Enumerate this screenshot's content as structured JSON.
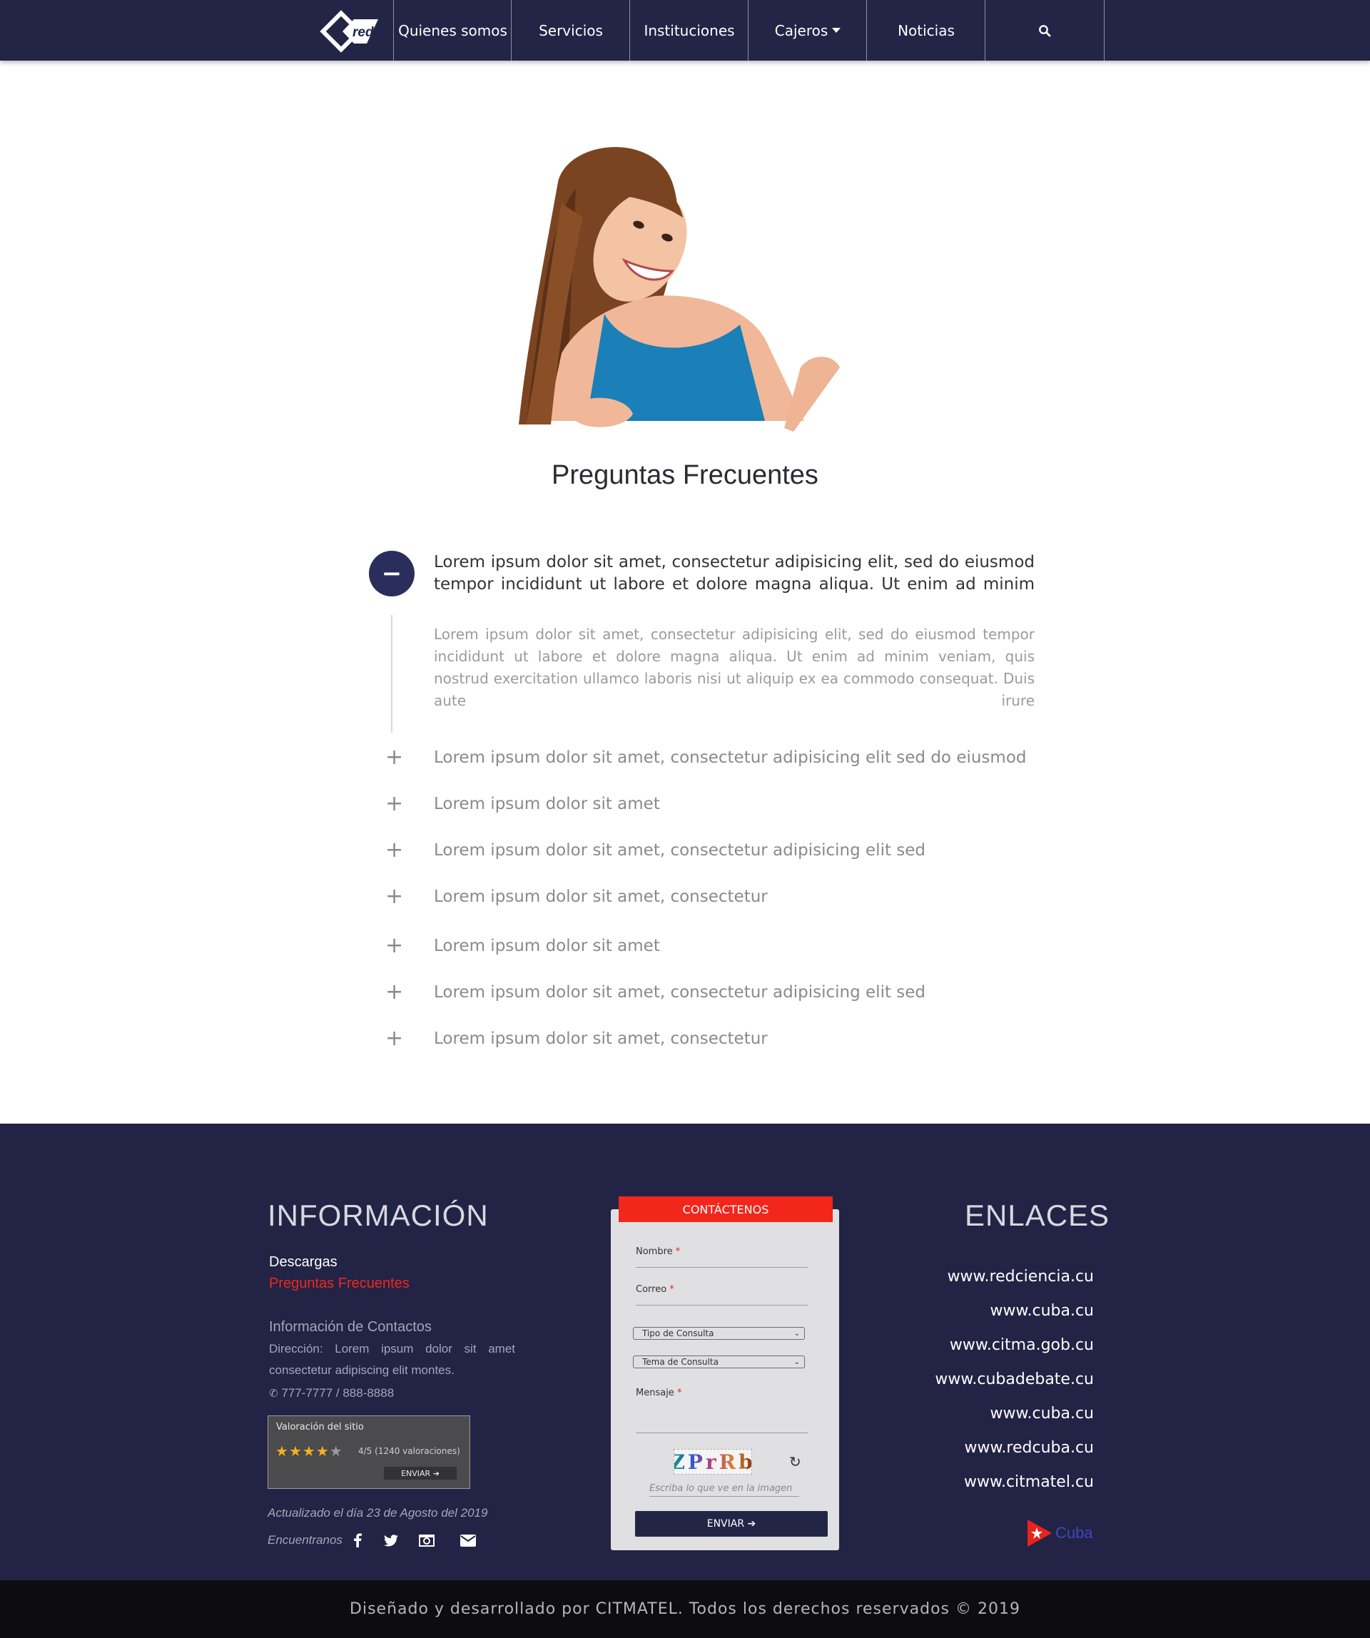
{
  "nav": {
    "logo_text": "red",
    "items": [
      {
        "label": "Quienes somos"
      },
      {
        "label": "Servicios"
      },
      {
        "label": "Instituciones"
      },
      {
        "label": "Cajeros"
      },
      {
        "label": "Noticias"
      }
    ],
    "search_icon": "search-icon"
  },
  "hero": {
    "image": "woman-pointing-down-photo"
  },
  "page_title": "Preguntas Frecuentes",
  "faq": {
    "open": {
      "toggle_symbol": "−",
      "question": "Lorem ipsum dolor sit amet, consectetur adipisicing elit, sed do eiusmod tempor incididunt ut labore et dolore magna aliqua. Ut enim ad minim",
      "answer": "Lorem ipsum dolor sit amet, consectetur adipisicing elit, sed do eiusmod tempor incididunt ut labore et dolore magna aliqua. Ut enim ad minim veniam, quis nostrud exercitation ullamco laboris nisi ut aliquip ex ea commodo consequat. Duis aute irure"
    },
    "toggle_symbol": "+",
    "items": [
      {
        "question": "Lorem ipsum dolor sit amet, consectetur adipisicing elit sed do eiusmod"
      },
      {
        "question": "Lorem ipsum dolor sit amet"
      },
      {
        "question": "Lorem ipsum dolor sit amet, consectetur adipisicing elit sed"
      },
      {
        "question": "Lorem ipsum dolor sit amet, consectetur"
      },
      {
        "question": "Lorem ipsum dolor sit amet"
      },
      {
        "question": "Lorem ipsum dolor sit amet, consectetur adipisicing elit sed"
      },
      {
        "question": "Lorem ipsum dolor sit amet, consectetur"
      }
    ]
  },
  "footer": {
    "info": {
      "title": "INFORMACIÓN",
      "downloads": "Descargas",
      "faq_link": "Preguntas Frecuentes",
      "contacts_title": "Información de Contactos",
      "address": "Dirección: Lorem ipsum dolor sit amet consectetur adipiscing elit montes.",
      "phone": "777-7777 / 888-8888",
      "rating": {
        "title": "Valoración del sitio",
        "stars_filled": 4,
        "stars_total": 5,
        "value": "4/5",
        "count": "(1240 valoraciones)",
        "submit": "ENVIAR"
      },
      "updated": "Actualizado el día 23 de Agosto del 2019",
      "find_us": "Encuentranos",
      "social": [
        "facebook-icon",
        "twitter-icon",
        "camera-icon",
        "envelope-icon"
      ]
    },
    "contact": {
      "header": "CONTÁCTENOS",
      "name_label": "Nombre",
      "email_label": "Correo",
      "required_mark": "*",
      "type_select": "Tipo de Consulta",
      "topic_select": "Tema de Consulta",
      "message_label": "Mensaje",
      "captcha_text": "ZPrRb",
      "captcha_hint": "Escriba lo que ve en la imagen",
      "submit": "ENVIAR"
    },
    "links": {
      "title": "ENLACES",
      "items": [
        "www.redciencia.cu",
        "www.cuba.cu",
        "www.citma.gob.cu",
        "www.cubadebate.cu",
        "www.cuba.cu",
        "www.redcuba.cu",
        "www.citmatel.cu"
      ],
      "cuba_logo_text": "Cuba"
    }
  },
  "copyright": "Diseñado y desarrollado por CITMATEL. Todos los derechos reservados © 2019",
  "colors": {
    "navy": "#222546",
    "accent_red": "#f3261c",
    "footer_bg": "#222345",
    "star": "#f2b21d"
  }
}
